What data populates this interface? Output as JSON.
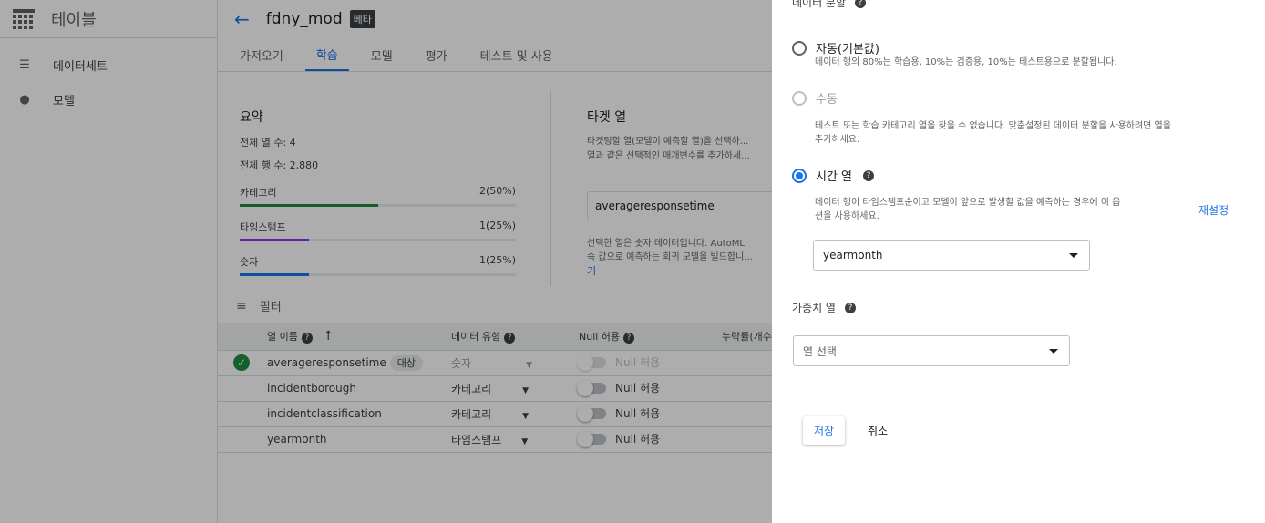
{
  "nav": {
    "title": "테이블",
    "items": [
      {
        "label": "데이터세트",
        "icon": "list-icon"
      },
      {
        "label": "모델",
        "icon": "lightbulb-icon"
      }
    ]
  },
  "header": {
    "dataset_name": "fdny_mod",
    "badge": "베타"
  },
  "tabs": [
    {
      "label": "가져오기"
    },
    {
      "label": "학습",
      "active": true
    },
    {
      "label": "모델"
    },
    {
      "label": "평가"
    },
    {
      "label": "테스트 및 사용"
    }
  ],
  "summary": {
    "title": "요약",
    "total_cols": "전체 열 수: 4",
    "total_rows": "전체 행 수: 2,880",
    "bars": [
      {
        "label": "카테고리",
        "value": "2(50%)",
        "fraction": 0.5,
        "color": "#1e8e3e"
      },
      {
        "label": "타임스탬프",
        "value": "1(25%)",
        "fraction": 0.25,
        "color": "#9334e6"
      },
      {
        "label": "숫자",
        "value": "1(25%)",
        "fraction": 0.25,
        "color": "#1a73e8"
      }
    ]
  },
  "target": {
    "title": "타겟 열",
    "desc1": "타겟팅할 열(모델이 예측할 열)을 선택하...",
    "desc2": "열과 같은 선택적인 매개변수를 추가하세...",
    "value": "averageresponsetime",
    "desc3": "선택한 열은 숫자 데이터입니다. AutoML",
    "desc4": "속 값으로 예측하는 회귀 모델을 빌드합니...",
    "link": "기"
  },
  "filter": {
    "label": "필터"
  },
  "table": {
    "headers": [
      "열 이름",
      "데이터 유형",
      "Null 허용",
      "누락률(개수"
    ],
    "rows": [
      {
        "name": "averageresponsetime",
        "chip": "대상",
        "type": "숫자",
        "nullable": "Null 허용",
        "target": true
      },
      {
        "name": "incidentborough",
        "chip": "",
        "type": "카테고리",
        "nullable": "Null 허용",
        "target": false
      },
      {
        "name": "incidentclassification",
        "chip": "",
        "type": "카테고리",
        "nullable": "Null 허용",
        "target": false
      },
      {
        "name": "yearmonth",
        "chip": "",
        "type": "타임스탬프",
        "nullable": "Null 허용",
        "target": false
      }
    ]
  },
  "panel": {
    "split_title": "데이터 분할",
    "auto": {
      "label": "자동(기본값)",
      "desc": "데이터 행의 80%는 학습용, 10%는 검증용, 10%는 테스트용으로 분할됩니다."
    },
    "manual": {
      "label": "수동",
      "desc1": "테스트 또는 학습 카테고리 열을 찾을 수 없습니다. 맞춤설정된 데이터 분할을 사용하려면 열을",
      "desc2": "추가하세요."
    },
    "time": {
      "label": "시간 열",
      "desc1": "데이터 행이 타임스탬프순이고 모델이 앞으로 발생할 값을 예측하는 경우에 이 옵",
      "desc2": "션을 사용하세요.",
      "reset": "재설정",
      "value": "yearmonth"
    },
    "weight": {
      "title": "가중치 열",
      "placeholder": "열 선택"
    },
    "save": "저장",
    "cancel": "취소"
  }
}
